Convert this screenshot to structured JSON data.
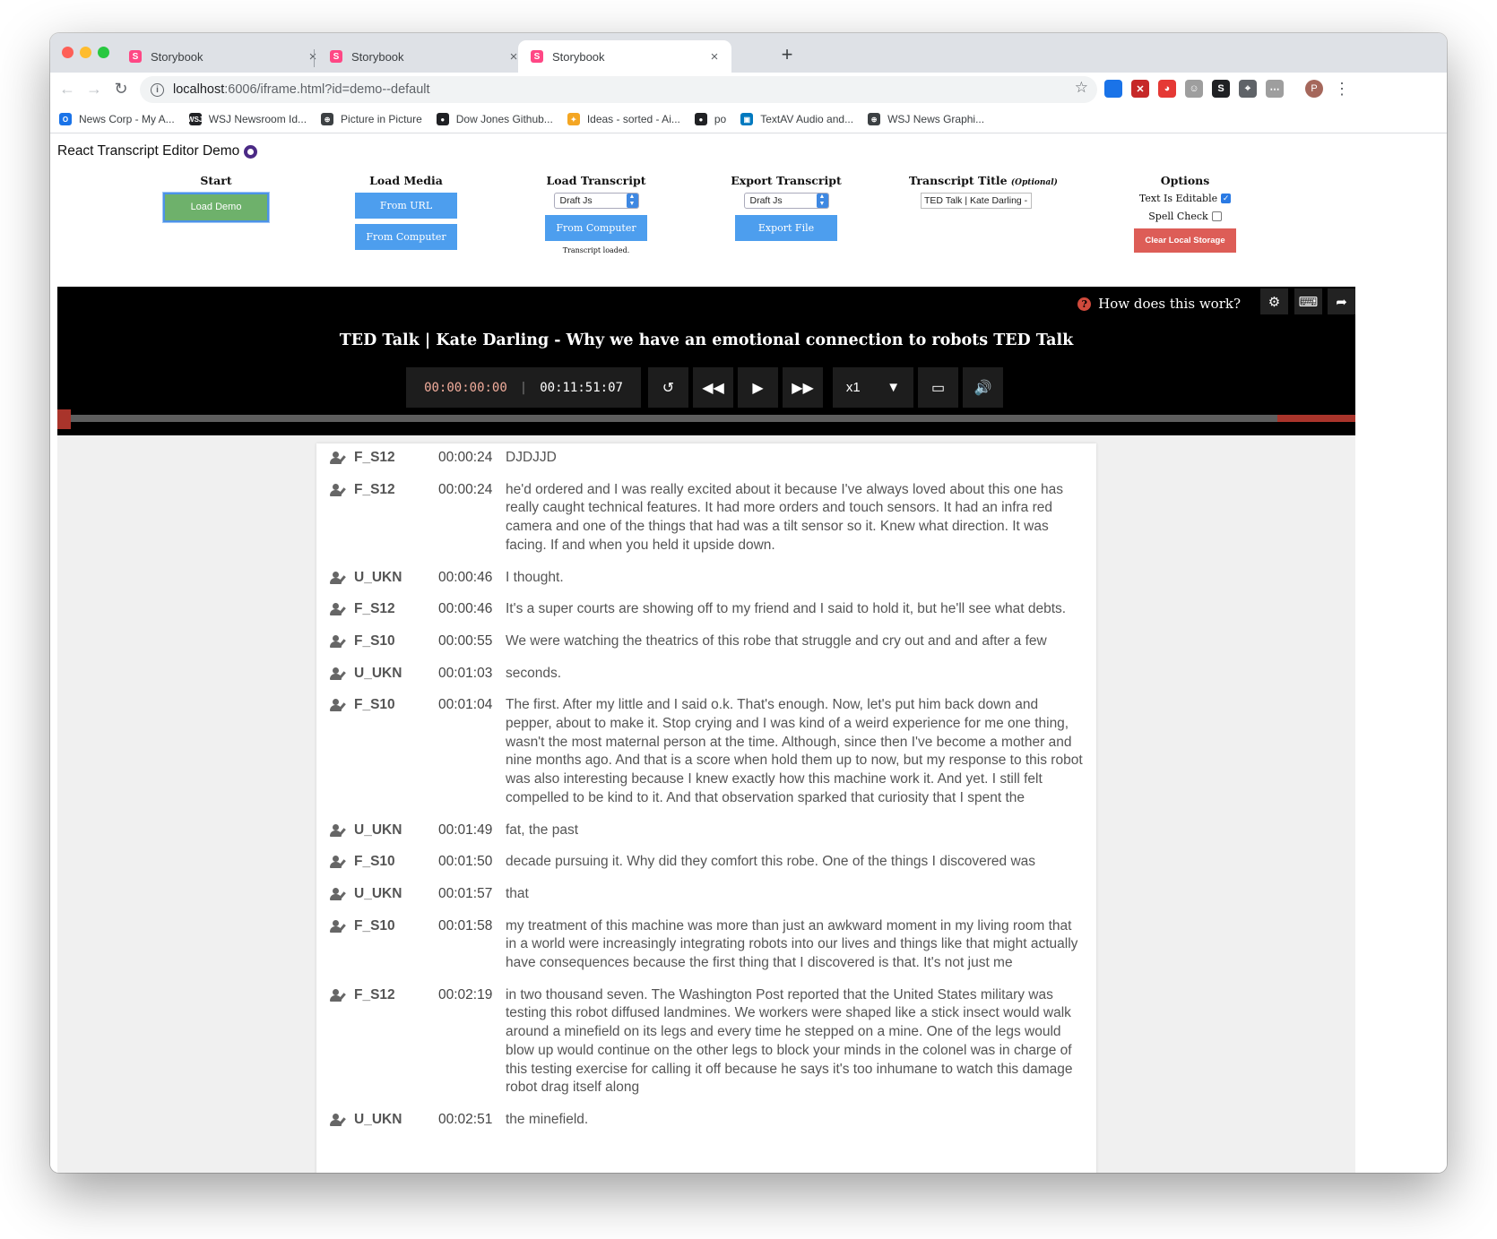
{
  "browser": {
    "tabs": [
      {
        "favicon": "S",
        "title": "Storybook",
        "close": "×"
      },
      {
        "favicon": "S",
        "title": "Storybook",
        "close": "×"
      },
      {
        "favicon": "S",
        "title": "Storybook",
        "close": "×"
      }
    ],
    "new_tab": "+",
    "url_host": "localhost",
    "url_path": ":6006/iframe.html?id=demo--default",
    "extensions": [
      {
        "icon": "ring-extension-icon",
        "glyph": "",
        "color": "#1a73e8"
      },
      {
        "icon": "puzzle-extension-icon",
        "glyph": "✕",
        "color": "#c62828"
      },
      {
        "icon": "chart-extension-icon",
        "glyph": "◕",
        "color": "#e53935"
      },
      {
        "icon": "robot-extension-icon",
        "glyph": "☺",
        "color": "#9e9e9e"
      },
      {
        "icon": "dollar-extension-icon",
        "glyph": "S",
        "color": "#202124"
      },
      {
        "icon": "pin-extension-icon",
        "glyph": "⌖",
        "color": "#5f6368"
      },
      {
        "icon": "code-extension-icon",
        "glyph": "⋯",
        "color": "#9e9e9e"
      }
    ],
    "profile_initial": "P",
    "bookmarks": [
      {
        "icon": "O",
        "color": "#1a73e8",
        "label": "News Corp - My A..."
      },
      {
        "icon": "WSJ",
        "color": "#202124",
        "label": "WSJ Newsroom Id..."
      },
      {
        "icon": "⊕",
        "color": "#3c4043",
        "label": "Picture in Picture"
      },
      {
        "icon": "●",
        "color": "#202124",
        "label": "Dow Jones Github..."
      },
      {
        "icon": "✦",
        "color": "#f4a623",
        "label": "Ideas - sorted - Ai..."
      },
      {
        "icon": "●",
        "color": "#202124",
        "label": "po"
      },
      {
        "icon": "▣",
        "color": "#0079bf",
        "label": "TextAV Audio and..."
      },
      {
        "icon": "⊕",
        "color": "#3c4043",
        "label": "WSJ News Graphi..."
      }
    ]
  },
  "app": {
    "title": "React Transcript Editor Demo",
    "start": {
      "heading": "Start",
      "load_demo": "Load Demo"
    },
    "load_media": {
      "heading": "Load Media",
      "from_url": "From URL",
      "from_computer": "From Computer"
    },
    "load_transcript": {
      "heading": "Load Transcript",
      "format": "Draft Js",
      "from_computer": "From Computer",
      "status": "Transcript loaded."
    },
    "export_transcript": {
      "heading": "Export Transcript",
      "format": "Draft Js",
      "export_file": "Export File"
    },
    "transcript_title": {
      "heading": "Transcript Title",
      "optional": "(Optional)",
      "value": "TED Talk | Kate Darling -"
    },
    "options": {
      "heading": "Options",
      "text_editable": "Text Is Editable",
      "text_editable_checked": true,
      "spell_check": "Spell Check",
      "spell_check_checked": false,
      "clear_storage": "Clear Local Storage"
    }
  },
  "player": {
    "help_text": "How does this work?",
    "title": "TED Talk | Kate Darling - Why we have an emotional connection to robots TED Talk",
    "current_time": "00:00:00:00",
    "separator": "|",
    "duration": "00:11:51:07",
    "playback_rate": "x1",
    "progress_fraction": 0
  },
  "transcript": [
    {
      "speaker": "F_S12",
      "time": "00:00:24",
      "text": "DJDJJD"
    },
    {
      "speaker": "F_S12",
      "time": "00:00:24",
      "text": "he'd ordered and I was really excited about it because I've always loved about this one has really caught technical features. It had more orders and touch sensors. It had an infra red camera and one of the things that had was a tilt sensor so it. Knew what direction. It was facing. If and when you held it upside down."
    },
    {
      "speaker": "U_UKN",
      "time": "00:00:46",
      "text": "I thought."
    },
    {
      "speaker": "F_S12",
      "time": "00:00:46",
      "text": "It's a super courts are showing off to my friend and I said to hold it, but he'll see what debts."
    },
    {
      "speaker": "F_S10",
      "time": "00:00:55",
      "text": "We were watching the theatrics of this robe that struggle and cry out and and after a few"
    },
    {
      "speaker": "U_UKN",
      "time": "00:01:03",
      "text": "seconds."
    },
    {
      "speaker": "F_S10",
      "time": "00:01:04",
      "text": "The first. After my little and I said o.k. That's enough. Now, let's put him back down and pepper, about to make it. Stop crying and I was kind of a weird experience for me one thing, wasn't the most maternal person at the time. Although, since then I've become a mother and nine months ago. And that is a score when hold them up to now, but my response to this robot was also interesting because I knew exactly how this machine work it. And yet. I still felt compelled to be kind to it. And that observation sparked that curiosity that I spent the"
    },
    {
      "speaker": "U_UKN",
      "time": "00:01:49",
      "text": "fat, the past"
    },
    {
      "speaker": "F_S10",
      "time": "00:01:50",
      "text": "decade pursuing it. Why did they comfort this robe. One of the things I discovered was"
    },
    {
      "speaker": "U_UKN",
      "time": "00:01:57",
      "text": "that"
    },
    {
      "speaker": "F_S10",
      "time": "00:01:58",
      "text": "my treatment of this machine was more than just an awkward moment in my living room that in a world were increasingly integrating robots into our lives and things like that might actually have consequences because the first thing that I discovered is that. It's not just me"
    },
    {
      "speaker": "F_S12",
      "time": "00:02:19",
      "text": "in two thousand seven. The Washington Post reported that the United States military was testing this robot diffused landmines. We workers were shaped like a stick insect would walk around a minefield on its legs and every time he stepped on a mine. One of the legs would blow up would continue on the other legs to block your minds in the colonel was in charge of this testing exercise for calling it off because he says it's too inhumane to watch this damage robot drag itself along"
    },
    {
      "speaker": "U_UKN",
      "time": "00:02:51",
      "text": "the minefield."
    }
  ]
}
